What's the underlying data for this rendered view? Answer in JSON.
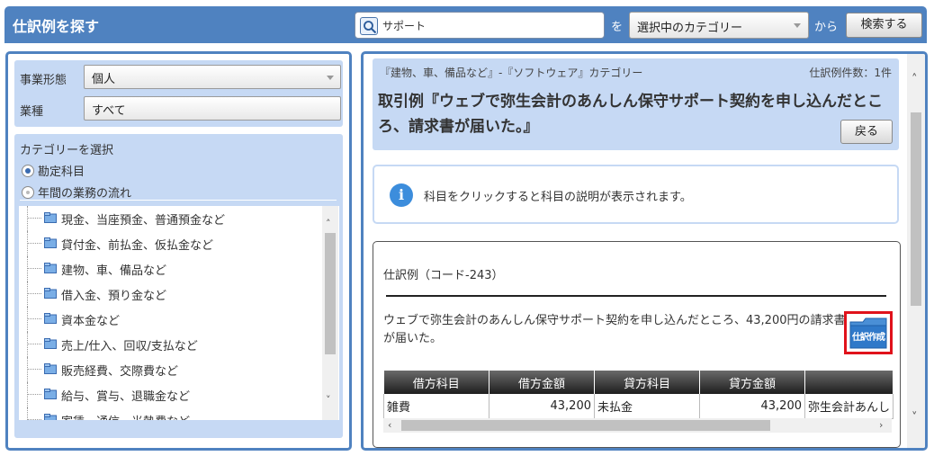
{
  "header": {
    "title": "仕訳例を探す",
    "search_value": "サポート",
    "wo_label": "を",
    "category_select": "選択中のカテゴリー",
    "kara_label": "から",
    "search_button": "検索する"
  },
  "filters": {
    "business_type_label": "事業形態",
    "business_type_value": "個人",
    "industry_label": "業種",
    "industry_value": "すべて"
  },
  "category": {
    "title": "カテゴリーを選択",
    "radios": [
      {
        "label": "勘定科目",
        "selected": true
      },
      {
        "label": "年間の業務の流れ",
        "selected": false
      }
    ],
    "tree_items": [
      "現金、当座預金、普通預金など",
      "貸付金、前払金、仮払金など",
      "建物、車、備品など",
      "借入金、預り金など",
      "資本金など",
      "売上/仕入、回収/支払など",
      "販売経費、交際費など",
      "給与、賞与、退職金など",
      "家賃、通信、光熱費など"
    ]
  },
  "topic": {
    "breadcrumb": "『建物、車、備品など』-『ソフトウェア』カテゴリー",
    "count": "仕訳例件数：1件",
    "title": "取引例『ウェブで弥生会計のあんしん保守サポート契約を申し込んだところ、請求書が届いた。』",
    "back_button": "戻る"
  },
  "info": {
    "text": "科目をクリックすると科目の説明が表示されます。"
  },
  "entry": {
    "code": "仕訳例（コード-243）",
    "description": "ウェブで弥生会計のあんしん保守サポート契約を申し込んだところ、43,200円の請求書が届いた。",
    "create_button_label": "仕訳作成",
    "columns": [
      "借方科目",
      "借方金額",
      "貸方科目",
      "貸方金額",
      ""
    ],
    "rows": [
      [
        "雑費",
        "43,200",
        "未払金",
        "43,200",
        "弥生会計あんし"
      ]
    ]
  },
  "colors": {
    "header_blue": "#4f82c0",
    "panel_light_blue": "#c6d9f4",
    "highlight_red": "#e0121b"
  }
}
